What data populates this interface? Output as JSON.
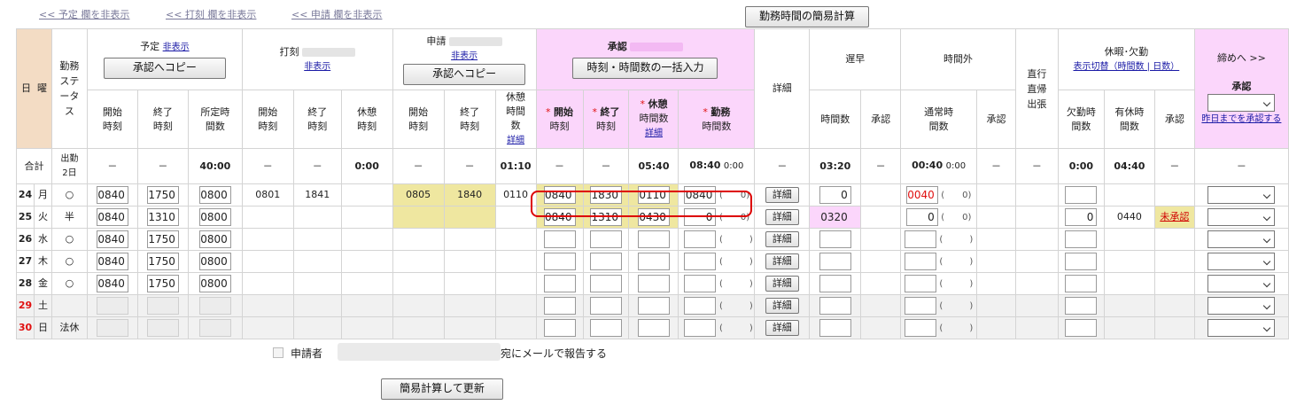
{
  "top_links": [
    "<< 予定 欄を非表示",
    "<< 打刻 欄を非表示",
    "<< 申請 欄を非表示"
  ],
  "calc_button": "勤務時間の簡易計算",
  "header": {
    "day": "日",
    "weekday": "曜",
    "status": "勤務ステータス",
    "plan_label": "予定",
    "hide": "非表示",
    "copy_to_approval": "承認へコピー",
    "stamp_label": "打刻",
    "request_label": "申請",
    "approval_label": "承認",
    "bulk_input": "時刻・時間数の一括入力",
    "detail": "詳細",
    "late_early": "遅早",
    "overtime": "時間外",
    "direct": "直行直帰出張",
    "leave": "休暇･欠勤",
    "toggle_display": "表示切替（時間数 | 日数）",
    "close": "締めへ >>",
    "close_approval": "承認",
    "approve_until_yesterday": "昨日までを承認する",
    "start_time": "開始時刻",
    "end_time": "終了時刻",
    "scheduled_hours": "所定時間数",
    "break_time": "休憩時刻",
    "break_hours": "休憩時間数",
    "detail_link": "詳細",
    "req_start": "開始",
    "req_end": "終了",
    "req_break": "休憩",
    "req_work": "勤務",
    "time_label": "時刻",
    "hours_label": "時間数",
    "approve": "承認",
    "regular_hours": "通常時間数",
    "absence_hours": "欠勤時間数",
    "paid_hours": "有休時間数",
    "required_mark": "*"
  },
  "summary": {
    "label": "合計",
    "status": "出勤2日",
    "dash": "－",
    "plan_total": "40:00",
    "stamp_break": "0:00",
    "req_break": "01:10",
    "appr_break": "05:40",
    "appr_work": "08:40",
    "appr_work_zero": "0:00",
    "late": "03:20",
    "overtime": "00:40",
    "overtime_zero": "0:00",
    "absence": "0:00",
    "paid": "04:40"
  },
  "rows": [
    {
      "day": "24",
      "wd": "月",
      "wd_color": "normal",
      "status": "○",
      "plan": [
        "0840",
        "1750",
        "0800"
      ],
      "stamp": [
        "0801",
        "1841",
        ""
      ],
      "req": [
        "0805",
        "1840",
        "0110"
      ],
      "appr": [
        "0840",
        "1830",
        "0110",
        "0840"
      ],
      "appr_paren": "(　　0)",
      "late": "0",
      "late_bg": "",
      "ot": "0040",
      "ot_red": true,
      "ot_paren": "(　　0)",
      "absence": "",
      "paid": "",
      "leave_appr": "",
      "closed": false,
      "yellow": true
    },
    {
      "day": "25",
      "wd": "火",
      "wd_color": "normal",
      "status": "半",
      "plan": [
        "0840",
        "1310",
        "0800"
      ],
      "stamp": [
        "",
        "",
        ""
      ],
      "req": [
        "",
        "",
        ""
      ],
      "appr": [
        "0840",
        "1310",
        "0430",
        "0"
      ],
      "appr_paren": "(　　0)",
      "late": "0320",
      "late_bg": "pk",
      "ot": "0",
      "ot_red": false,
      "ot_paren": "(　　0)",
      "absence": "0",
      "paid": "0440",
      "leave_appr": "未承認",
      "closed": false,
      "yellow": true
    },
    {
      "day": "26",
      "wd": "水",
      "wd_color": "normal",
      "status": "○",
      "plan": [
        "0840",
        "1750",
        "0800"
      ],
      "stamp": [
        "",
        "",
        ""
      ],
      "req": [
        "",
        "",
        ""
      ],
      "appr": [
        "",
        "",
        "",
        ""
      ],
      "appr_paren": "(　　　)",
      "late": "",
      "late_bg": "",
      "ot": "",
      "ot_red": false,
      "ot_paren": "(　　　)",
      "absence": "",
      "paid": "",
      "leave_appr": "",
      "closed": false,
      "yellow": false
    },
    {
      "day": "27",
      "wd": "木",
      "wd_color": "normal",
      "status": "○",
      "plan": [
        "0840",
        "1750",
        "0800"
      ],
      "stamp": [
        "",
        "",
        ""
      ],
      "req": [
        "",
        "",
        ""
      ],
      "appr": [
        "",
        "",
        "",
        ""
      ],
      "appr_paren": "(　　　)",
      "late": "",
      "late_bg": "",
      "ot": "",
      "ot_red": false,
      "ot_paren": "(　　　)",
      "absence": "",
      "paid": "",
      "leave_appr": "",
      "closed": false,
      "yellow": false
    },
    {
      "day": "28",
      "wd": "金",
      "wd_color": "normal",
      "status": "○",
      "plan": [
        "0840",
        "1750",
        "0800"
      ],
      "stamp": [
        "",
        "",
        ""
      ],
      "req": [
        "",
        "",
        ""
      ],
      "appr": [
        "",
        "",
        "",
        ""
      ],
      "appr_paren": "(　　　)",
      "late": "",
      "late_bg": "",
      "ot": "",
      "ot_red": false,
      "ot_paren": "(　　　)",
      "absence": "",
      "paid": "",
      "leave_appr": "",
      "closed": false,
      "yellow": false
    },
    {
      "day": "29",
      "wd": "土",
      "wd_color": "red",
      "status": "",
      "plan": [
        "",
        "",
        ""
      ],
      "stamp": [
        "",
        "",
        ""
      ],
      "req": [
        "",
        "",
        ""
      ],
      "appr": [
        "",
        "",
        "",
        ""
      ],
      "appr_paren": "(　　　)",
      "late": "",
      "late_bg": "",
      "ot": "",
      "ot_red": false,
      "ot_paren": "(　　　)",
      "absence": "",
      "paid": "",
      "leave_appr": "",
      "closed": true,
      "yellow": false
    },
    {
      "day": "30",
      "wd": "日",
      "wd_color": "red",
      "status": "法休",
      "plan": [
        "",
        "",
        ""
      ],
      "stamp": [
        "",
        "",
        ""
      ],
      "req": [
        "",
        "",
        ""
      ],
      "appr": [
        "",
        "",
        "",
        ""
      ],
      "appr_paren": "(　　　)",
      "late": "",
      "late_bg": "",
      "ot": "",
      "ot_red": false,
      "ot_paren": "(　　　)",
      "absence": "",
      "paid": "",
      "leave_appr": "",
      "closed": true,
      "yellow": false
    }
  ],
  "bottom": {
    "applicant": "申請者",
    "mail_report": "宛にメールで報告する",
    "update_button": "簡易計算して更新"
  },
  "colors": {
    "approval_header": "#fbd6fb",
    "day_header": "#f3dcc4",
    "yellow_cell": "#efe7a0",
    "alert": "#d00000"
  }
}
